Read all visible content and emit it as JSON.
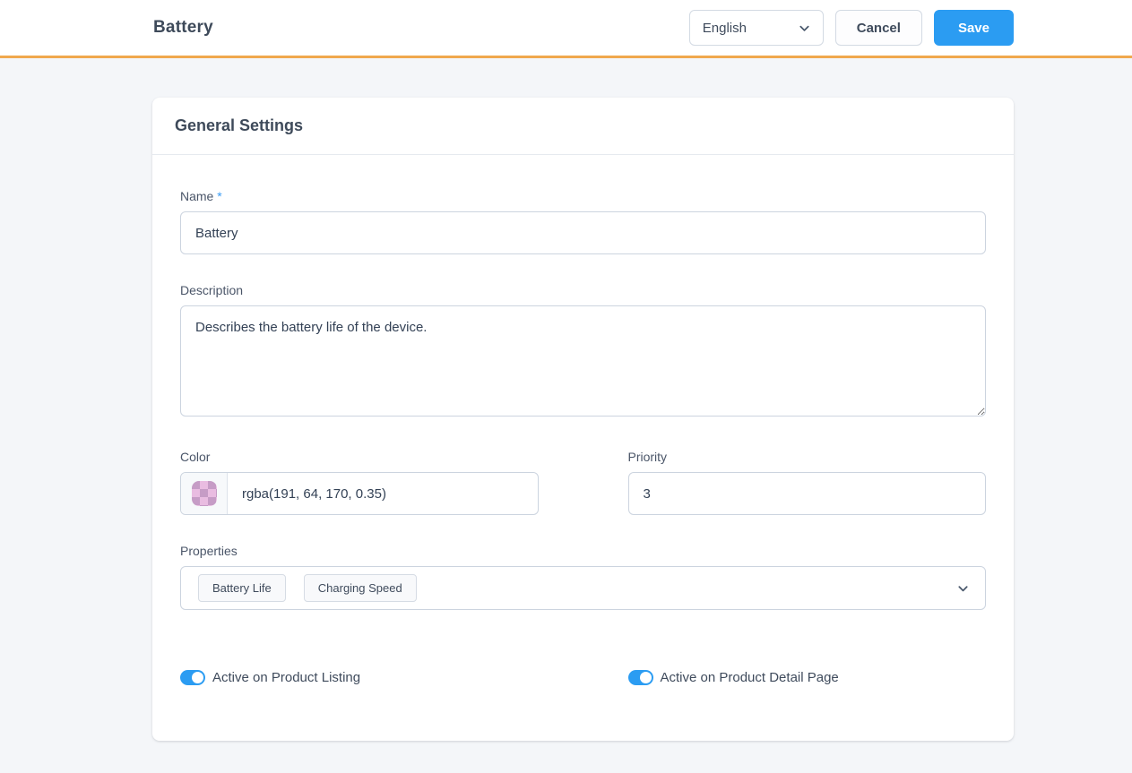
{
  "header": {
    "title": "Battery",
    "language_select": {
      "value": "English"
    },
    "cancel_label": "Cancel",
    "save_label": "Save"
  },
  "card": {
    "title": "General Settings",
    "fields": {
      "name": {
        "label": "Name",
        "required_marker": "*",
        "value": "Battery"
      },
      "description": {
        "label": "Description",
        "value": "Describes the battery life of the device."
      },
      "color": {
        "label": "Color",
        "value": "rgba(191, 64, 170, 0.35)",
        "swatch_style": "background-color: rgba(191, 64, 170, 0.35)"
      },
      "priority": {
        "label": "Priority",
        "value": "3"
      },
      "properties": {
        "label": "Properties",
        "tags": [
          "Battery Life",
          "Charging Speed"
        ]
      }
    },
    "toggles": [
      {
        "label": "Active on Product Listing",
        "on": true
      },
      {
        "label": "Active on Product Detail Page",
        "on": true
      }
    ]
  },
  "colors": {
    "accent_blue": "#2b9cf2",
    "accent_orange": "#f0a84d"
  }
}
